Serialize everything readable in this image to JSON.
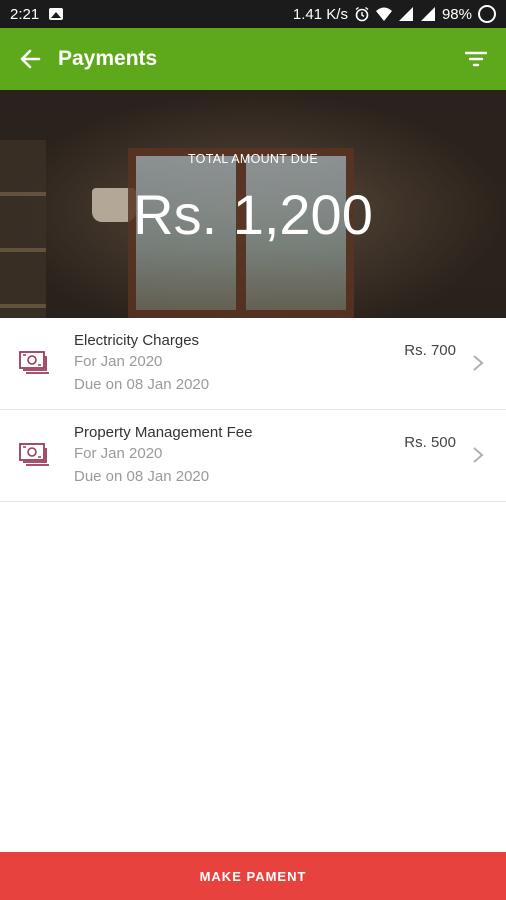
{
  "status_bar": {
    "time": "2:21",
    "speed": "1.41 K/s",
    "battery": "98%"
  },
  "app_bar": {
    "title": "Payments"
  },
  "summary": {
    "label": "TOTAL AMOUNT DUE",
    "amount": "Rs. 1,200"
  },
  "payments": [
    {
      "name": "Electricity Charges",
      "period": "For Jan 2020",
      "due": "Due on 08 Jan 2020",
      "amount": "Rs. 700"
    },
    {
      "name": "Property Management Fee",
      "period": "For Jan 2020",
      "due": "Due on 08 Jan 2020",
      "amount": "Rs. 500"
    }
  ],
  "footer": {
    "button_label": "MAKE PAMENT"
  },
  "colors": {
    "app_bar": "#5ea91b",
    "cta": "#e8423f",
    "bill_icon": "#9b3a57"
  }
}
